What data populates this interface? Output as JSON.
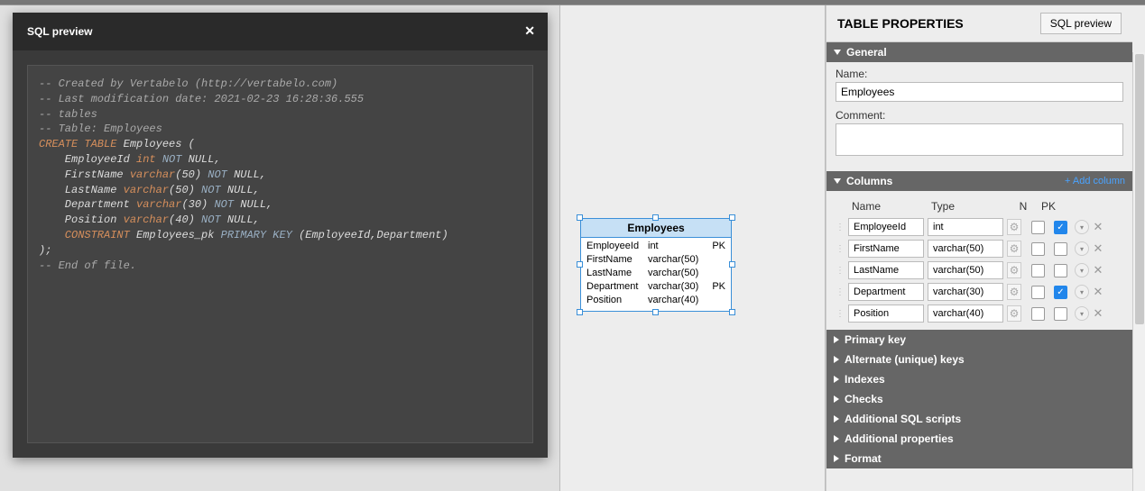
{
  "modal": {
    "title": "SQL preview",
    "sql": {
      "comment1": "-- Created by Vertabelo (http://vertabelo.com)",
      "comment2": "-- Last modification date: 2021-02-23 16:28:36.555",
      "comment3": "-- tables",
      "comment4": "-- Table: Employees",
      "create": "CREATE TABLE",
      "table_name": "Employees (",
      "col1_name": "    EmployeeId ",
      "col1_type": "int",
      "not_null": " NOT",
      "null": " NULL",
      "comma": ",",
      "col2_name": "    FirstName ",
      "col2_type": "varchar",
      "p50": "(50)",
      "col3_name": "    LastName ",
      "col4_name": "    Department ",
      "p30": "(30)",
      "col5_name": "    Position ",
      "p40": "(40)",
      "constraint": "    CONSTRAINT",
      "pk_name": " Employees_pk ",
      "pk": "PRIMARY KEY",
      "pk_cols": " (EmployeeId,Department)",
      "close": ");",
      "eof": "-- End of file."
    }
  },
  "entity": {
    "title": "Employees",
    "pk_label": "PK",
    "rows": [
      {
        "name": "EmployeeId",
        "type": "int",
        "pk": "PK"
      },
      {
        "name": "FirstName",
        "type": "varchar(50)",
        "pk": ""
      },
      {
        "name": "LastName",
        "type": "varchar(50)",
        "pk": ""
      },
      {
        "name": "Department",
        "type": "varchar(30)",
        "pk": "PK"
      },
      {
        "name": "Position",
        "type": "varchar(40)",
        "pk": ""
      }
    ]
  },
  "panel": {
    "title": "TABLE PROPERTIES",
    "sql_btn": "SQL preview",
    "general": {
      "title": "General",
      "name_label": "Name:",
      "name_value": "Employees",
      "comment_label": "Comment:",
      "comment_value": ""
    },
    "columns": {
      "title": "Columns",
      "add": "+ Add column",
      "h_name": "Name",
      "h_type": "Type",
      "h_n": "N",
      "h_pk": "PK",
      "rows": [
        {
          "name": "EmployeeId",
          "type": "int",
          "n": false,
          "pk": true
        },
        {
          "name": "FirstName",
          "type": "varchar(50)",
          "n": false,
          "pk": false
        },
        {
          "name": "LastName",
          "type": "varchar(50)",
          "n": false,
          "pk": false
        },
        {
          "name": "Department",
          "type": "varchar(30)",
          "n": false,
          "pk": true
        },
        {
          "name": "Position",
          "type": "varchar(40)",
          "n": false,
          "pk": false
        }
      ]
    },
    "sections": {
      "primary_key": "Primary key",
      "alt_keys": "Alternate (unique) keys",
      "indexes": "Indexes",
      "checks": "Checks",
      "sql_scripts": "Additional SQL scripts",
      "add_props": "Additional properties",
      "format": "Format"
    }
  }
}
